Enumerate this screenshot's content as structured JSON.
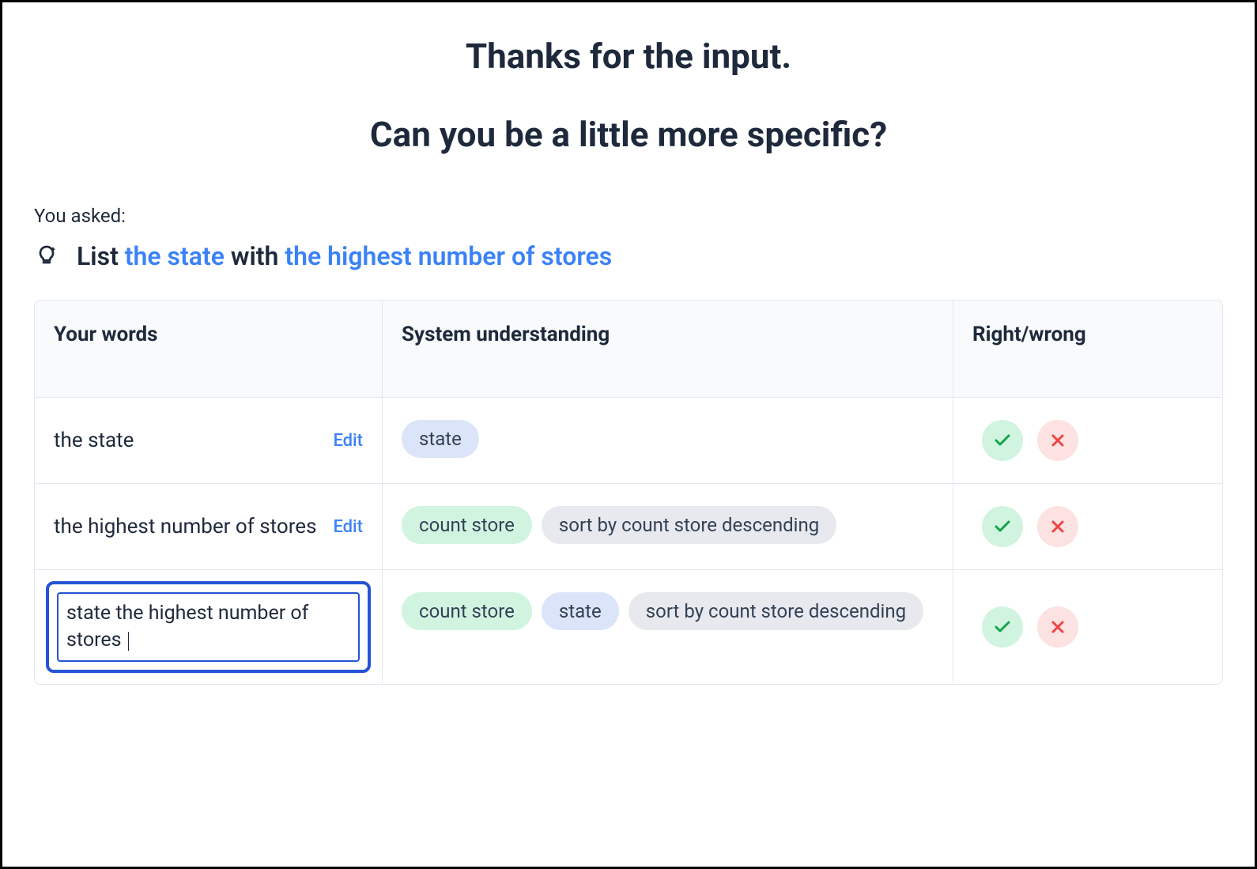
{
  "heading": {
    "line1": "Thanks for the input.",
    "line2": "Can you be a little more specific?"
  },
  "you_asked_label": "You asked:",
  "query": {
    "parts": [
      "List ",
      "the state",
      " with ",
      "the highest number of stores"
    ]
  },
  "columns": {
    "words": "Your words",
    "system": "System understanding",
    "rightwrong": "Right/wrong"
  },
  "edit_label": "Edit",
  "rows": [
    {
      "words": "the state",
      "chips": [
        {
          "text": "state",
          "color": "blue"
        }
      ]
    },
    {
      "words": "the highest number of stores",
      "chips": [
        {
          "text": "count store",
          "color": "green"
        },
        {
          "text": "sort by count store descending",
          "color": "gray"
        }
      ]
    },
    {
      "editing": true,
      "input_value": "state the highest number of stores ",
      "chips": [
        {
          "text": "count store",
          "color": "green"
        },
        {
          "text": "state",
          "color": "blue"
        },
        {
          "text": "sort by count store descending",
          "color": "gray"
        }
      ]
    }
  ]
}
